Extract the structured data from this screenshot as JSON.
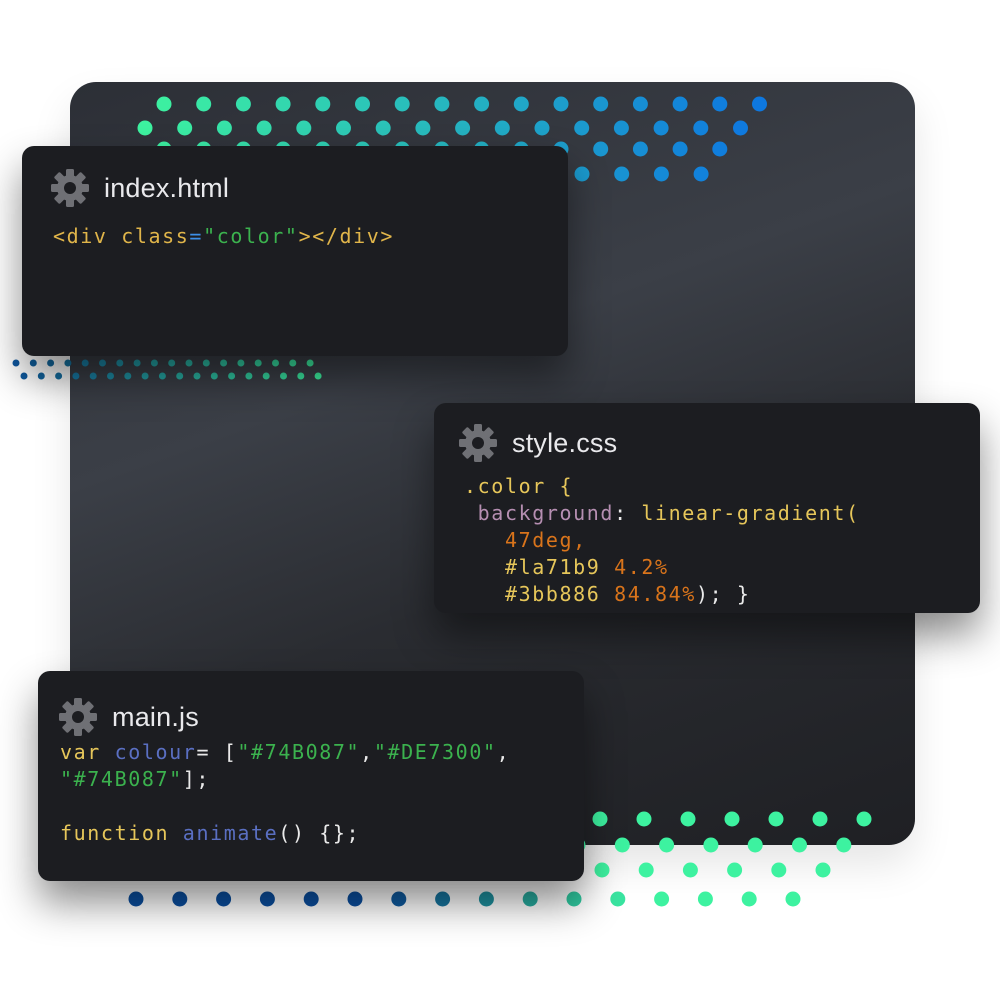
{
  "colors": {
    "background_panel": "#33363d",
    "card": "#1c1d21",
    "dot_blue": "#0e78e0",
    "dot_green": "#3df2a0",
    "dot_navy": "#0b4fa0"
  },
  "cards": {
    "html": {
      "icon": "gear-icon",
      "filename": "index.html",
      "code": {
        "open_tag": "<div class",
        "equals": "=",
        "value": "\"color\"",
        "close": "></div>"
      }
    },
    "css": {
      "icon": "gear-icon",
      "filename": "style.css",
      "code": {
        "selector": ".color {",
        "property": "background",
        "colon": ": ",
        "function": "linear-gradient(",
        "angle": "47deg,",
        "color1": "#la71b9",
        "stop1": "4.2%",
        "color2": "#3bb886",
        "stop2": "84.84%",
        "end": "); }"
      }
    },
    "js": {
      "icon": "gear-icon",
      "filename": "main.js",
      "code": {
        "keyword": "var",
        "name": "colour",
        "assign": "= [",
        "item1": "\"#74B087\"",
        "comma1": ",",
        "item2": "\"#DE7300\"",
        "comma2": ",",
        "item3": "\"#74B087\"",
        "array_end": "];",
        "fn_keyword": "function",
        "fn_name": "animate",
        "fn_rest": "() {};"
      }
    }
  }
}
